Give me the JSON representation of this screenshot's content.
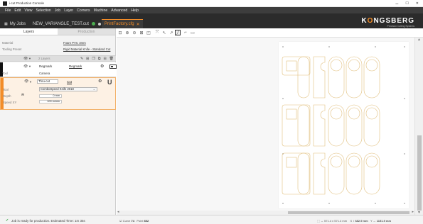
{
  "window": {
    "title": "i-cut Production Console",
    "controls": {
      "minimize": "–",
      "maximize": "☐",
      "close": "✕"
    }
  },
  "menu": [
    "File",
    "Edit",
    "View",
    "Selection",
    "Job",
    "Layer",
    "Corners",
    "Machine",
    "Advanced",
    "Help"
  ],
  "tabs": {
    "my_jobs": "My Jobs",
    "job_name": "NEW_VARIANGLE_TEST.cut",
    "active_tab": "PrintFactory.cfg",
    "close": "✕"
  },
  "logo": {
    "brand_pre": "K",
    "brand_o": "O",
    "brand_post": "NGSBERG",
    "subtitle": "Precision Cutting Systems"
  },
  "panel": {
    "tabs": [
      "Layers",
      "Production"
    ],
    "material_label": "Material",
    "material_value": "Foam PVC 3mm",
    "tooling_label": "Tooling Preset",
    "tooling_value": "Rigid Material Knife - Standard Cut",
    "layers_count": "2 Layers",
    "layers": [
      {
        "name": "Regmark",
        "link": "Regmark",
        "tool_label": "Tool",
        "tool_value": "Camera",
        "color": "#111111"
      },
      {
        "name": "Thru-cut",
        "link": "Cut",
        "tool_label": "Tool",
        "tool_value": "ComboSpeed Knife 2018",
        "depth_label": "Depth",
        "depth_value": "0 mm",
        "speed_label": "Speed XY",
        "speed_value": "100 m/min",
        "color": "#f28c28"
      }
    ]
  },
  "toolbar_icons": [
    "select-icon",
    "zoom-in-icon",
    "zoom-out-icon",
    "zoom-fit-icon",
    "zoom-window-icon",
    "node-icon",
    "pointer-icon",
    "pointer-alt-icon",
    "pen-icon",
    "line-icon",
    "rectangle-icon"
  ],
  "status": {
    "message": "Job is ready for production. Estimated Time: 1m 35s",
    "curve_label": "Curve",
    "curve_value": "74",
    "point_label": "Point",
    "point_value": "602",
    "size": "571.4 x 571.4 mm",
    "x": "682.9 mm",
    "y": "1151.9 mm"
  },
  "colors": {
    "accent": "#f28c28",
    "dark": "#2b2b2b",
    "menu": "#3d3d3d",
    "success": "#3aa84a",
    "cut_line": "#e1bf7d"
  }
}
